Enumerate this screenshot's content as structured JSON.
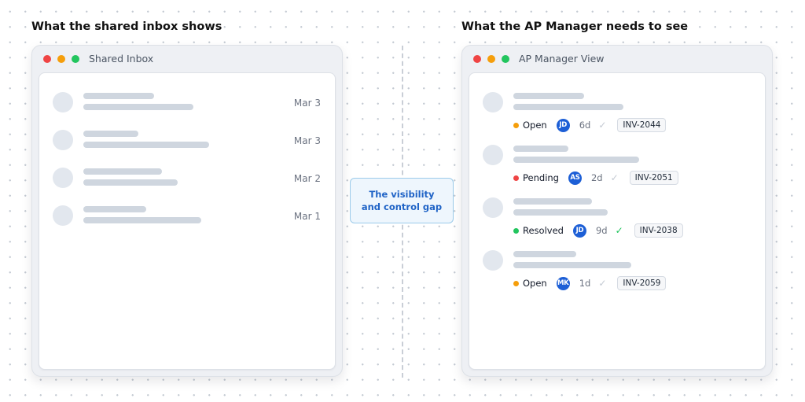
{
  "headings": {
    "left": "What the shared inbox shows",
    "right": "What the AP Manager needs to see"
  },
  "colors": {
    "accent": "#1d5fd6",
    "open": "#f59e0b",
    "pending": "#ef4444",
    "resolved": "#22c55e"
  },
  "shared_inbox": {
    "title": "Shared Inbox",
    "rows": [
      {
        "date": "Mar 3"
      },
      {
        "date": "Mar 3"
      },
      {
        "date": "Mar 2"
      },
      {
        "date": "Mar 1"
      }
    ]
  },
  "callout": {
    "text": "The visibility and control gap"
  },
  "ap_manager": {
    "title": "AP Manager View",
    "rows": [
      {
        "status": "Open",
        "status_color": "#f59e0b",
        "assignee": "JD",
        "age": "6d",
        "check_icon": "check-icon",
        "check_color": "#c3c9d2",
        "invoice": "INV-2044"
      },
      {
        "status": "Pending",
        "status_color": "#ef4444",
        "assignee": "AS",
        "age": "2d",
        "check_icon": "check-icon",
        "check_color": "#c3c9d2",
        "invoice": "INV-2051"
      },
      {
        "status": "Resolved",
        "status_color": "#22c55e",
        "assignee": "JD",
        "age": "9d",
        "check_icon": "check-icon",
        "check_color": "#22c55e",
        "invoice": "INV-2038"
      },
      {
        "status": "Open",
        "status_color": "#f59e0b",
        "assignee": "MK",
        "age": "1d",
        "check_icon": "check-icon",
        "check_color": "#c3c9d2",
        "invoice": "INV-2059"
      }
    ]
  }
}
